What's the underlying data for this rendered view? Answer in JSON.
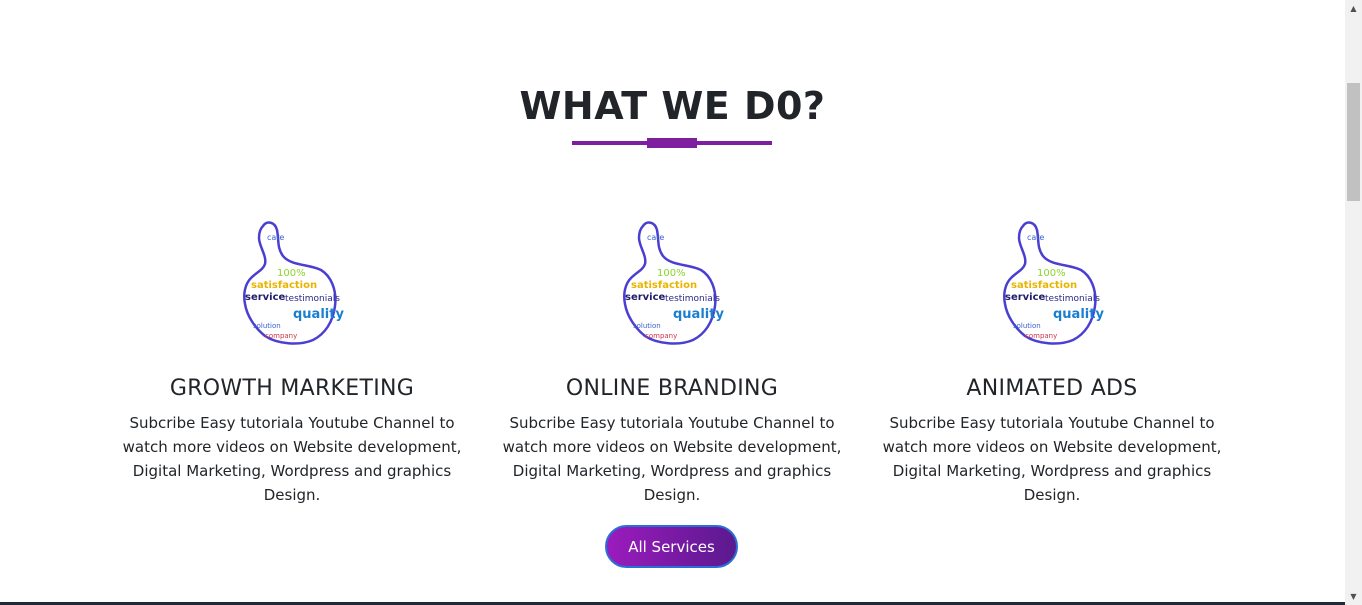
{
  "section": {
    "title": "WHAT WE D0?"
  },
  "services": [
    {
      "title": "GROWTH MARKETING",
      "description": "Subcribe Easy tutoriala Youtube Channel to watch more videos on Website development, Digital Marketing, Wordpress and graphics Design.",
      "icon": "thumbs-up-word-cloud-icon"
    },
    {
      "title": "ONLINE BRANDING",
      "description": "Subcribe Easy tutoriala Youtube Channel to watch more videos on Website development, Digital Marketing, Wordpress and graphics Design.",
      "icon": "thumbs-up-word-cloud-icon"
    },
    {
      "title": "ANIMATED ADS",
      "description": "Subcribe Easy tutoriala Youtube Channel to watch more videos on Website development, Digital Marketing, Wordpress and graphics Design.",
      "icon": "thumbs-up-word-cloud-icon"
    }
  ],
  "icon_words": {
    "care": "care",
    "hundred": "100%",
    "satisfaction": "satisfaction",
    "service": "service",
    "testimonials": "testimonials",
    "quality": "quality",
    "solution": "solution",
    "company": "company"
  },
  "cta": {
    "label": "All Services"
  },
  "colors": {
    "accent": "#7d1f9f",
    "button_gradient_start": "#9b1bbd",
    "button_gradient_end": "#5a1a8e",
    "button_border": "#2a6fd6",
    "text": "#212529",
    "icon_outline": "#4b3fd1"
  }
}
